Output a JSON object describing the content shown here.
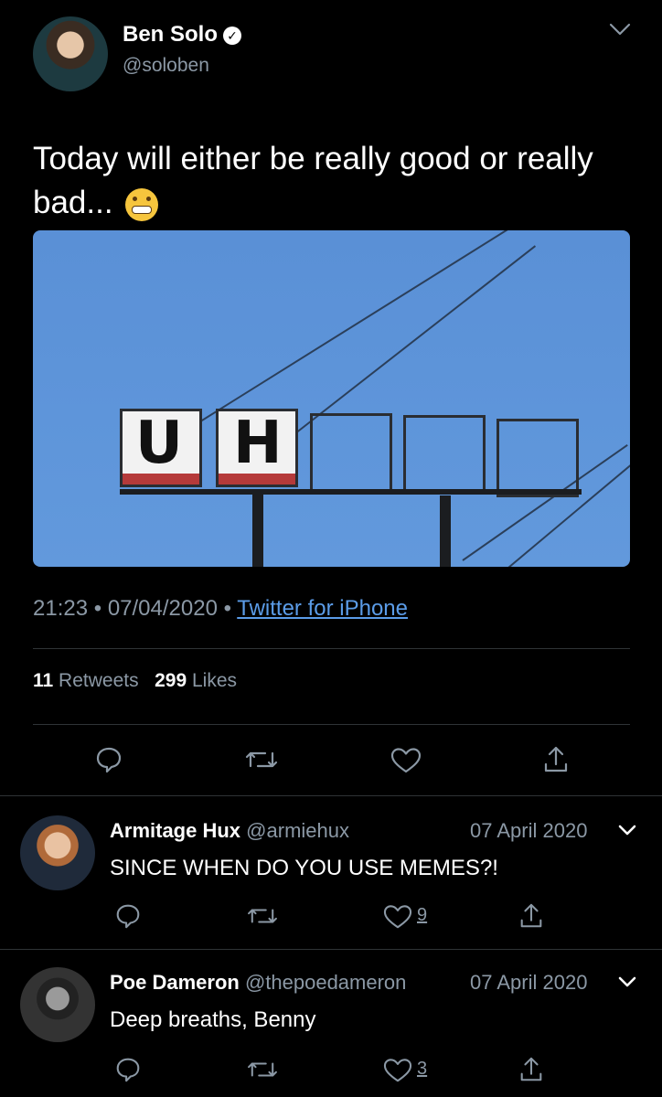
{
  "tweet": {
    "author_name": "Ben Solo",
    "author_handle": "@soloben",
    "text": "Today will either be really good or really bad...",
    "emoji": "😬",
    "time": "21:23",
    "date": "07/04/2020",
    "source": "Twitter for iPhone",
    "retweets_count": "11",
    "retweets_label": "Retweets",
    "likes_count": "299",
    "likes_label": "Likes",
    "image": {
      "sign_letters": [
        "U",
        "H"
      ],
      "empty_boxes": 3,
      "sky_color": "#5b8fd4"
    }
  },
  "replies": [
    {
      "name": "Armitage Hux",
      "handle": "@armiehux",
      "date": "07 April 2020",
      "text": "SINCE WHEN DO YOU USE MEMES?!",
      "like_count": "9"
    },
    {
      "name": "Poe Dameron",
      "handle": "@thepoedameron",
      "date": "07 April 2020",
      "text": "Deep breaths, Benny",
      "like_count": "3"
    }
  ],
  "colors": {
    "background": "#000000",
    "text": "#ffffff",
    "muted": "#8b98a5",
    "link": "#1d9bf0"
  }
}
